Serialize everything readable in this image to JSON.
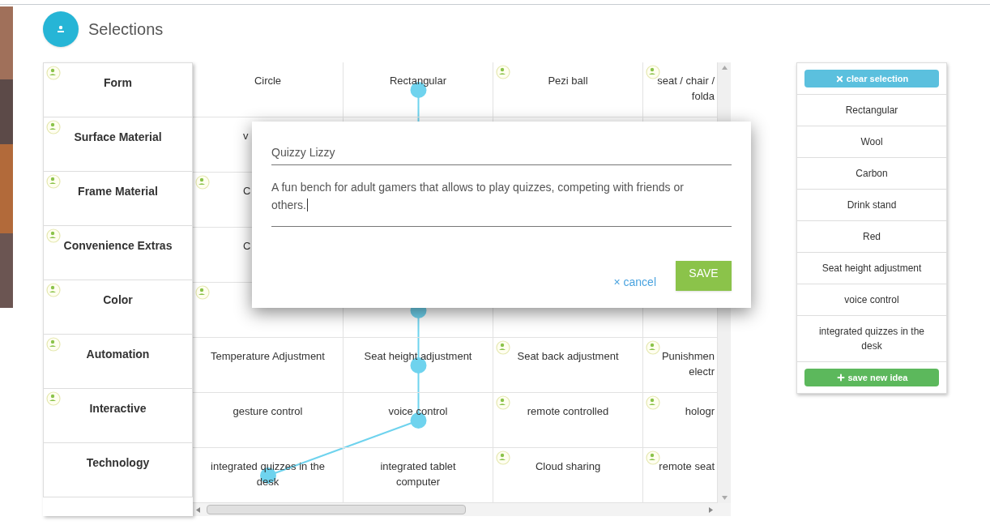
{
  "header": {
    "title": "Selections"
  },
  "grid": {
    "rows": [
      {
        "label": "Form",
        "avatar": true,
        "cells": [
          {
            "text": "Circle",
            "avatar": false,
            "selected": false
          },
          {
            "text": "Rectangular",
            "avatar": false,
            "selected": true
          },
          {
            "text": "Pezi ball",
            "avatar": true,
            "selected": false
          },
          {
            "text": "seat / chair /\nfolda",
            "avatar": true,
            "selected": false
          }
        ]
      },
      {
        "label": "Surface Material",
        "avatar": true,
        "cells": [
          {
            "kind": "clipped",
            "text": "v",
            "avatar": false
          }
        ]
      },
      {
        "label": "Frame Material",
        "avatar": true,
        "cells": [
          {
            "kind": "clipped",
            "text": "C",
            "avatar": true
          }
        ]
      },
      {
        "label": "Convenience Extras",
        "avatar": true,
        "cells": [
          {
            "kind": "clipped",
            "text": "C",
            "avatar": false
          }
        ]
      },
      {
        "label": "Color",
        "avatar": true,
        "cells": [
          {
            "avatar": true,
            "selected": false
          },
          {
            "avatar": false,
            "selected": true
          },
          {
            "selected": false
          },
          {
            "selected": false
          }
        ]
      },
      {
        "label": "Automation",
        "avatar": true,
        "cells": [
          {
            "text": "Temperature Adjustment",
            "avatar": false,
            "selected": false
          },
          {
            "text": "Seat height adjustment",
            "avatar": false,
            "selected": true
          },
          {
            "text": "Seat back adjustment",
            "avatar": true,
            "selected": false
          },
          {
            "text": "Punishmen\nelectr",
            "avatar": true,
            "selected": false
          }
        ]
      },
      {
        "label": "Interactive",
        "avatar": true,
        "cells": [
          {
            "text": "gesture control",
            "avatar": false,
            "selected": false
          },
          {
            "text": "voice control",
            "avatar": false,
            "selected": true
          },
          {
            "text": "remote controlled",
            "avatar": true,
            "selected": false
          },
          {
            "text": "hologr",
            "avatar": true,
            "selected": false
          }
        ]
      },
      {
        "label": "Technology",
        "avatar": false,
        "cells": [
          {
            "text": "integrated quizzes in the desk",
            "avatar": false,
            "selected": true
          },
          {
            "text": "integrated tablet computer",
            "avatar": false,
            "selected": false
          },
          {
            "text": "Cloud sharing",
            "avatar": true,
            "selected": false
          },
          {
            "text": "remote seat",
            "avatar": true,
            "selected": false
          }
        ]
      }
    ]
  },
  "modal": {
    "title_value": "Quizzy Lizzy",
    "description_value": "A fun bench for adult gamers that allows to play quizzes, competing with friends or others. ",
    "cancel_icon": "×",
    "cancel": "cancel",
    "save": "SAVE"
  },
  "selection_panel": {
    "clear_button": "clear selection",
    "items": [
      "Rectangular",
      "Wool",
      "Carbon",
      "Drink stand",
      "Red",
      "Seat height adjustment",
      "voice control",
      "integrated quizzes in the desk"
    ],
    "save_button": "save new idea"
  }
}
